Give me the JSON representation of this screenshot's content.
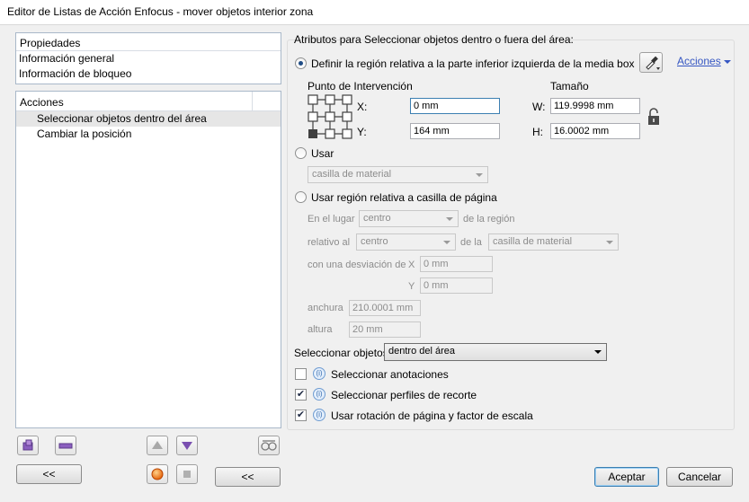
{
  "window": {
    "title": "Editor de Listas de Acción Enfocus - mover objetos interior zona"
  },
  "properties": {
    "header": "Propiedades",
    "items": [
      "Información general",
      "Información de bloqueo"
    ]
  },
  "actions": {
    "header": "Acciones",
    "items": [
      "Seleccionar objetos dentro del área",
      "Cambiar la posición"
    ]
  },
  "left_buttons": {
    "collapse_label": "<<"
  },
  "group": {
    "title": "Atributos para Seleccionar objetos dentro o fuera del área:",
    "actions_link": "Acciones",
    "radio_define": "Definir la región relativa a la parte inferior izquierda de la media box",
    "point_label": "Punto de Intervención",
    "size_label": "Tamaño",
    "x_label": "X:",
    "x_value": "0 mm",
    "y_label": "Y:",
    "y_value": "164 mm",
    "w_label": "W:",
    "w_value": "119.9998 mm",
    "h_label": "H:",
    "h_value": "16.0002 mm",
    "radio_use": "Usar",
    "use_combo": "casilla de material",
    "radio_page_box": "Usar región relativa a casilla de página",
    "in_place_label": "En el lugar",
    "in_place_combo": "centro",
    "of_region_label": "de la región",
    "relative_label": "relativo al",
    "relative_combo": "centro",
    "of_label": "de la",
    "of_combo": "casilla de material",
    "offset_label": "con una desviación de",
    "offset_x_label": "X",
    "offset_x_value": "0 mm",
    "offset_y_label": "Y",
    "offset_y_value": "0 mm",
    "width_label": "anchura",
    "width_value": "210.0001 mm",
    "height_label": "altura",
    "height_value": "20 mm",
    "select_objects_label": "Seleccionar objetos",
    "select_objects_combo": "dentro del área",
    "cb_annotations": "Seleccionar anotaciones",
    "cb_annotations_checked": false,
    "cb_clip": "Seleccionar perfiles de recorte",
    "cb_clip_checked": true,
    "cb_rotation": "Usar rotación de página y factor de escala",
    "cb_rotation_checked": true
  },
  "footer": {
    "collapse_label": "<<",
    "accept_label": "Aceptar",
    "cancel_label": "Cancelar"
  },
  "icons": {
    "add": "add-action-icon",
    "remove": "remove-action-icon",
    "up": "move-up-icon",
    "down": "move-down-icon",
    "preview": "preview-glasses-icon",
    "record": "record-icon",
    "stop": "stop-icon",
    "lock": "lock-icon",
    "eyedropper": "eyedropper-icon"
  }
}
